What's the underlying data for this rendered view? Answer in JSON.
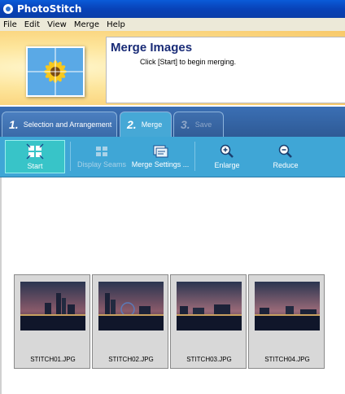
{
  "window": {
    "title": "PhotoStitch"
  },
  "menu": {
    "items": [
      "File",
      "Edit",
      "View",
      "Merge",
      "Help"
    ]
  },
  "banner": {
    "title": "Merge Images",
    "subtitle": "Click [Start] to begin merging."
  },
  "tabs": [
    {
      "number": "1.",
      "label": "Selection and Arrangement"
    },
    {
      "number": "2.",
      "label": "Merge"
    },
    {
      "number": "3.",
      "label": "Save"
    }
  ],
  "toolbar": {
    "start": "Start",
    "display_seams": "Display Seams",
    "merge_settings": "Merge Settings ...",
    "enlarge": "Enlarge",
    "reduce": "Reduce"
  },
  "images": [
    {
      "filename": "STITCH01.JPG"
    },
    {
      "filename": "STITCH02.JPG"
    },
    {
      "filename": "STITCH03.JPG"
    },
    {
      "filename": "STITCH04.JPG"
    }
  ]
}
